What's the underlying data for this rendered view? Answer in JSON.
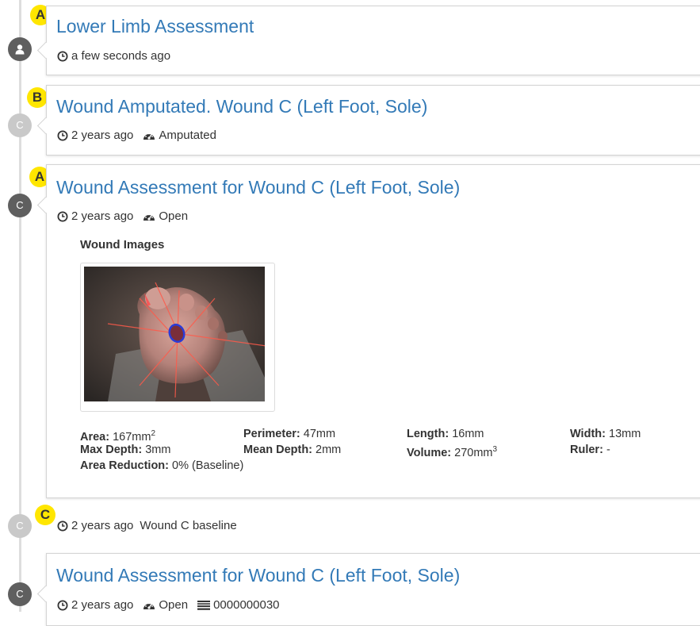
{
  "timeline": [
    {
      "badge": "A",
      "marker_letter": "",
      "marker_icon": "person-icon",
      "title": "Lower Limb Assessment",
      "time": "a few seconds ago"
    },
    {
      "badge": "B",
      "marker_letter": "C",
      "title": "Wound Amputated. Wound C (Left Foot, Sole)",
      "time": "2 years ago",
      "status": "Amputated"
    },
    {
      "badge": "A",
      "marker_letter": "C",
      "title": "Wound Assessment for Wound C (Left Foot, Sole)",
      "time": "2 years ago",
      "status": "Open",
      "images_label": "Wound Images",
      "measurements": {
        "area_label": "Area:",
        "area_value": "167mm",
        "area_sup": "2",
        "perimeter_label": "Perimeter:",
        "perimeter_value": "47mm",
        "length_label": "Length:",
        "length_value": "16mm",
        "width_label": "Width:",
        "width_value": "13mm",
        "max_depth_label": "Max Depth:",
        "max_depth_value": "3mm",
        "mean_depth_label": "Mean Depth:",
        "mean_depth_value": "2mm",
        "volume_label": "Volume:",
        "volume_value": "270mm",
        "volume_sup": "3",
        "ruler_label": "Ruler:",
        "ruler_value": "-",
        "area_reduction_label": "Area Reduction:",
        "area_reduction_value": "0% (Baseline)"
      }
    },
    {
      "badge": "C",
      "marker_letter": "C",
      "time": "2 years ago",
      "note": "Wound C baseline"
    },
    {
      "badge": "",
      "marker_letter": "C",
      "title": "Wound Assessment for Wound C (Left Foot, Sole)",
      "time": "2 years ago",
      "status": "Open",
      "id": "0000000030"
    }
  ],
  "colors": {
    "link": "#337ab7",
    "badge": "#ffe600",
    "marker_dark": "#5f5f5f",
    "marker_light": "#c9c9c9",
    "wound_outline": "#2b3bd6"
  },
  "icons": {
    "time": "clock-icon",
    "status": "dashboard-gauge-icon",
    "id": "barcode-icon"
  }
}
